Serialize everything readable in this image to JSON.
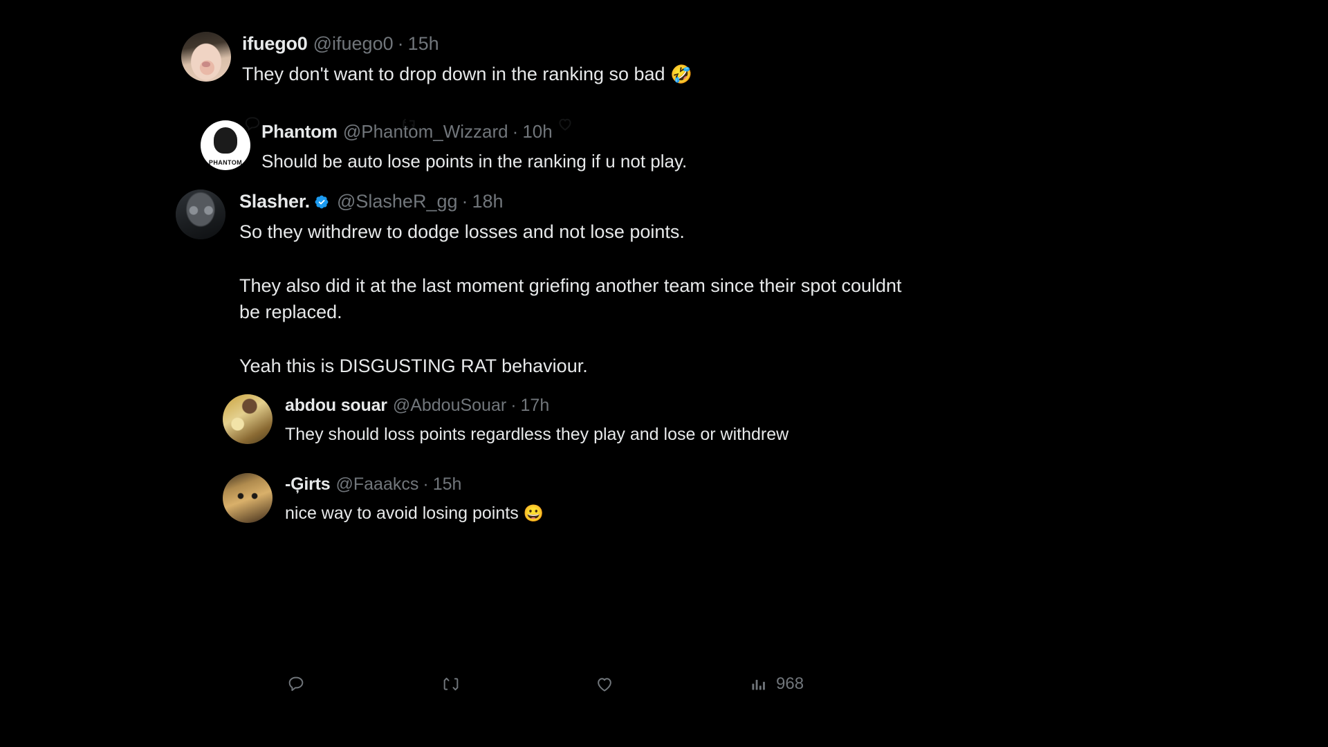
{
  "app": {
    "platform": "twitter-thread",
    "background_color": "#000000"
  },
  "colors": {
    "text": "#e7e9ea",
    "muted": "#71767b",
    "verified_blue": "#1d9bf0",
    "background": "#000000"
  },
  "tweets": [
    {
      "id": "ifuego",
      "name": "ifuego0",
      "handle": "@ifuego0",
      "separator": "·",
      "time": "15h",
      "verified": false,
      "text": "They don't want to drop down in the ranking so bad ",
      "emoji": "🤣",
      "avatar": "cat-nose-closeup"
    },
    {
      "id": "phantom",
      "name": "Phantom",
      "handle": "@Phantom_Wizzard",
      "separator": "·",
      "time": "10h",
      "verified": false,
      "text": "Should be auto lose points in the ranking if u not play.",
      "emoji": "",
      "avatar": "phantom-logo"
    },
    {
      "id": "slasher",
      "name": "Slasher.",
      "handle": "@SlasheR_gg",
      "separator": "·",
      "time": "18h",
      "verified": true,
      "text": "So they withdrew to dodge losses and not lose points.",
      "paragraphs": [
        "They also did it at the last moment griefing another team since their spot couldnt be replaced.",
        "Yeah this is DISGUSTING RAT behaviour."
      ],
      "emoji": "",
      "avatar": "dark-masked-figure"
    },
    {
      "id": "abdou",
      "name": "abdou souar",
      "handle": "@AbdouSouar",
      "separator": "·",
      "time": "17h",
      "verified": false,
      "text": "They should loss points regardless they play and lose or withdrew",
      "emoji": "",
      "avatar": "man-in-yellow-jacket"
    },
    {
      "id": "girts",
      "name": "-Ģirts",
      "handle": "@Faaakcs",
      "separator": "·",
      "time": "15h",
      "verified": false,
      "text": "nice way to avoid losing points ",
      "emoji": "😀",
      "avatar": "ginger-cat"
    }
  ],
  "actions": {
    "reply": {
      "icon": "reply-icon",
      "count": ""
    },
    "repost": {
      "icon": "repost-icon",
      "count": ""
    },
    "like": {
      "icon": "heart-icon",
      "count": ""
    },
    "views": {
      "icon": "analytics-bar-icon",
      "count": "968"
    }
  }
}
